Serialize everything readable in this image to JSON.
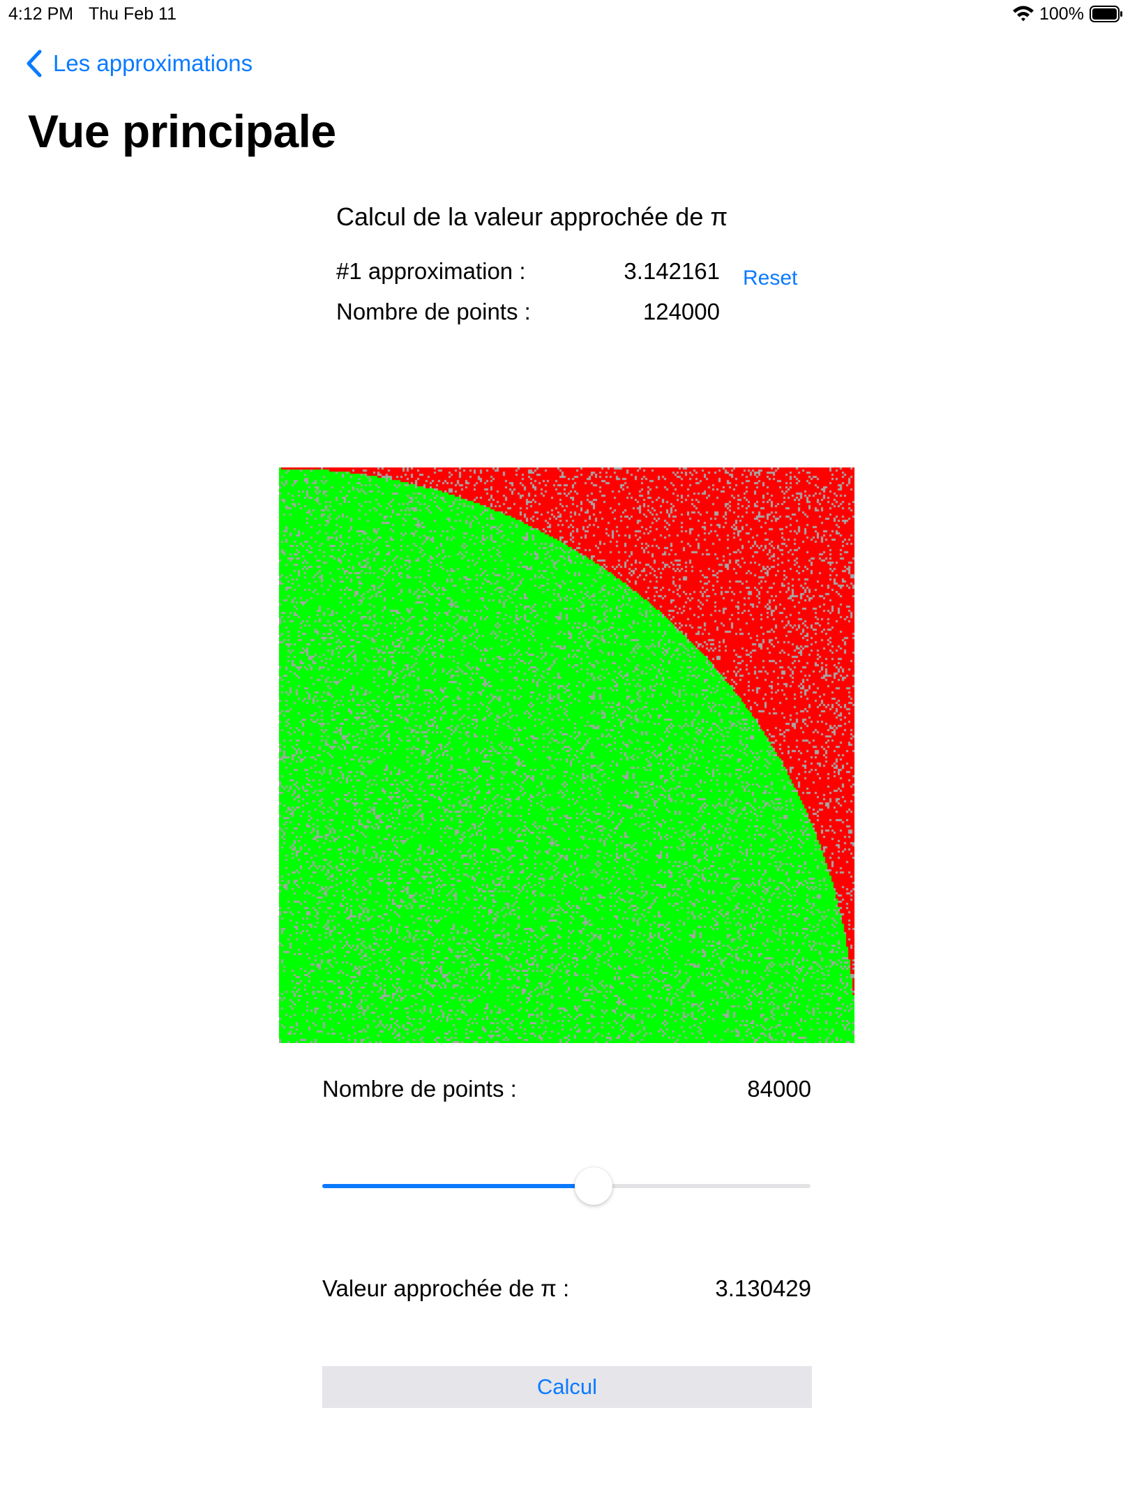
{
  "status_bar": {
    "time": "4:12 PM",
    "date": "Thu Feb 11",
    "battery_percent": "100%",
    "icons": [
      "wifi-icon",
      "battery-icon"
    ]
  },
  "nav": {
    "back_label": "Les approximations",
    "back_icon": "chevron-left-icon",
    "title": "Vue principale"
  },
  "summary": {
    "heading": "Calcul de la valeur approchée de π",
    "approximation_label": "#1 approximation :",
    "approximation_value": "3.142161",
    "points_label": "Nombre de points :",
    "points_value": "124000",
    "reset_label": "Reset"
  },
  "simulation": {
    "inside_color": "#00ff00",
    "outside_color": "#ff0000",
    "noise_color": "#a6a6a6"
  },
  "controls": {
    "points_label": "Nombre de points :",
    "points_value": "84000",
    "slider_fraction": 0.555,
    "pi_label": "Valeur approchée de π :",
    "pi_value": "3.130429",
    "calc_label": "Calcul",
    "accent_color": "#0a7aff"
  }
}
